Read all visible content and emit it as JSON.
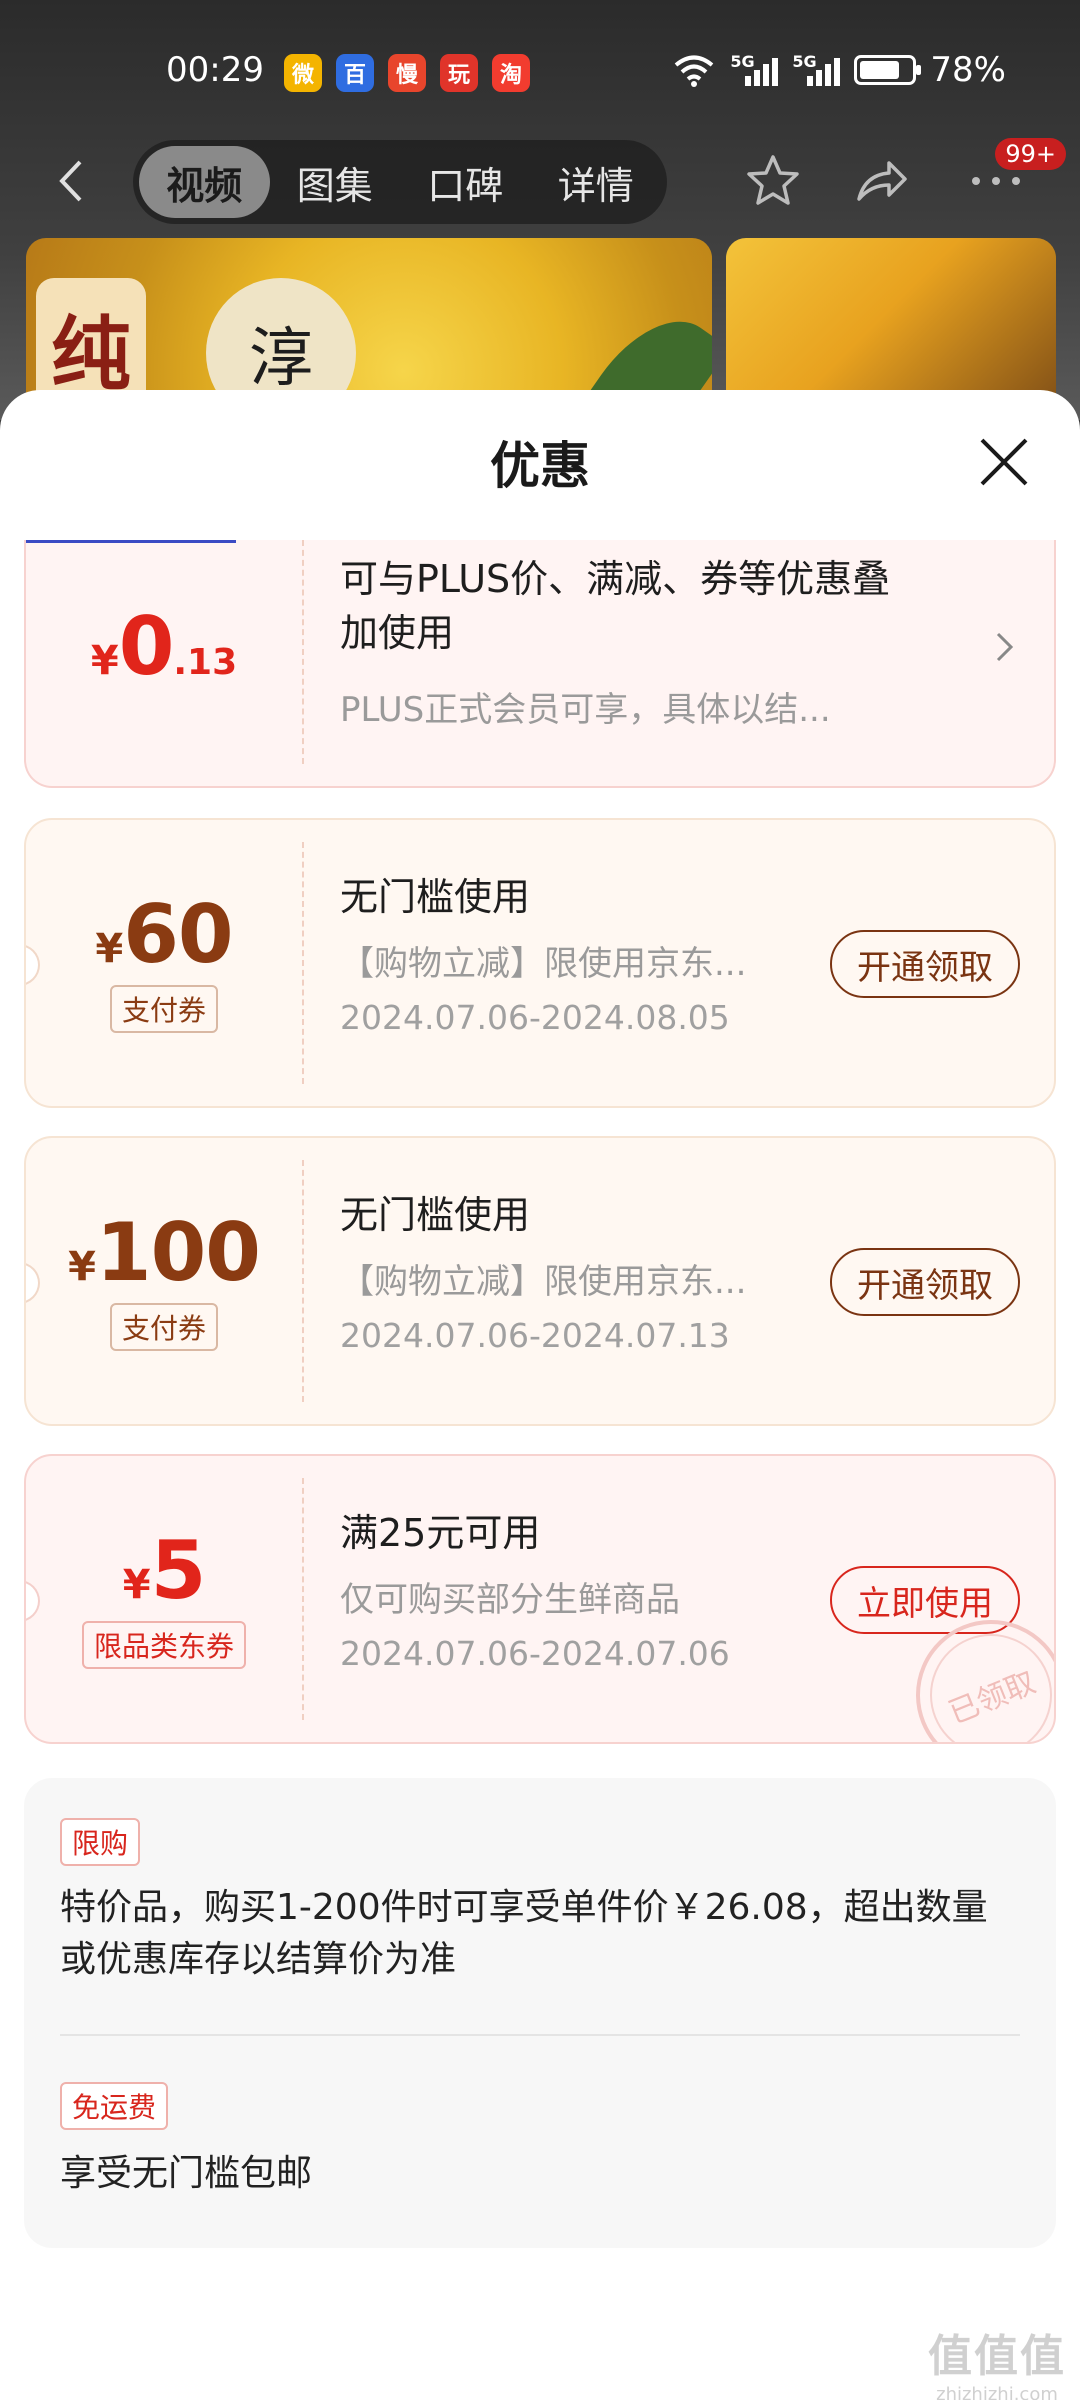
{
  "status_bar": {
    "time": "00:29",
    "apps": [
      {
        "icon": "weibo-icon",
        "glyph": "微",
        "color": "#f4b400"
      },
      {
        "icon": "baidu-icon",
        "glyph": "百",
        "color": "#2f6de1"
      },
      {
        "icon": "slow-app-icon",
        "glyph": "慢",
        "color": "#e8452c"
      },
      {
        "icon": "game-app-icon",
        "glyph": "玩",
        "color": "#e0342a"
      },
      {
        "icon": "taobao-icon",
        "glyph": "淘",
        "color": "#f23c2f"
      }
    ],
    "network": "5G",
    "battery": "78%",
    "battery_level": 0.78
  },
  "nav": {
    "tabs": [
      "视频",
      "图集",
      "口碑",
      "详情"
    ],
    "active_tab": 0,
    "badge": "99+"
  },
  "product_images": {
    "brand_char": "纯",
    "seal_char": "淳"
  },
  "sheet": {
    "title": "优惠"
  },
  "coupons": [
    {
      "style": "red",
      "amount_int": "0",
      "amount_dec": ".13",
      "currency": "¥",
      "title": "可与PLUS价、满减、券等优惠叠加使用",
      "subtitle": "PLUS正式会员可享，具体以结...",
      "has_chevron": true
    },
    {
      "style": "cream",
      "amount_int": "60",
      "currency": "¥",
      "tag": "支付券",
      "title": "无门槛使用",
      "subtitle": "【购物立减】限使用京东...",
      "date": "2024.07.06-2024.08.05",
      "button": "开通领取"
    },
    {
      "style": "cream",
      "amount_int": "100",
      "currency": "¥",
      "tag": "支付券",
      "title": "无门槛使用",
      "subtitle": "【购物立减】限使用京东...",
      "date": "2024.07.06-2024.07.13",
      "button": "开通领取"
    },
    {
      "style": "red",
      "amount_int": "5",
      "currency": "¥",
      "tag": "限品类东券",
      "title": "满25元可用",
      "subtitle": "仅可购买部分生鲜商品",
      "date": "2024.07.06-2024.07.06",
      "button": "立即使用",
      "stamp": "已领取"
    }
  ],
  "info": {
    "limit_label": "限购",
    "limit_text": "特价品，购买1-200件时可享受单件价￥26.08，超出数量或优惠库存以结算价为准",
    "shipping_label": "免运费",
    "shipping_text": "享受无门槛包邮"
  },
  "watermark": {
    "glyphs": "值值值",
    "site": "zhizhizhi.com"
  }
}
